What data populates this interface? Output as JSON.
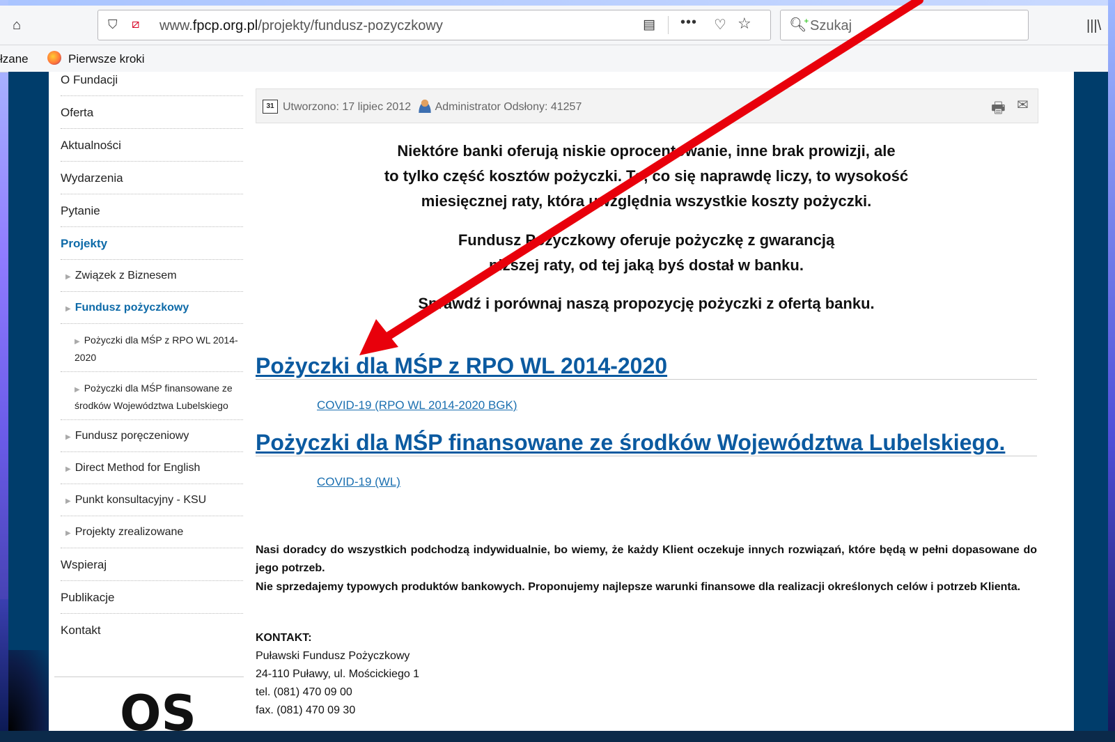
{
  "browser": {
    "url_prefix": "www.",
    "url_host": "fpcp.org.pl",
    "url_path": "/projekty/fundusz-pozyczkowy",
    "search_placeholder": "Szukaj",
    "bookmark_cut": "łzane",
    "bookmark_label": "Pierwsze kroki"
  },
  "sidebar": {
    "items": [
      {
        "label": "O Fundacji"
      },
      {
        "label": "Oferta"
      },
      {
        "label": "Aktualności"
      },
      {
        "label": "Wydarzenia"
      },
      {
        "label": "Pytanie"
      },
      {
        "label": "Projekty"
      }
    ],
    "sub": [
      {
        "label": "Związek z Biznesem"
      },
      {
        "label": "Fundusz pożyczkowy"
      }
    ],
    "subsub": [
      {
        "label": "Pożyczki dla MŚP z RPO WL 2014-2020"
      },
      {
        "label": "Pożyczki dla MŚP finansowane ze środków Województwa Lubelskiego"
      }
    ],
    "sub2": [
      {
        "label": "Fundusz poręczeniowy"
      },
      {
        "label": "Direct Method for English"
      },
      {
        "label": "Punkt konsultacyjny - KSU"
      },
      {
        "label": "Projekty zrealizowane"
      }
    ],
    "items2": [
      {
        "label": "Wspieraj"
      },
      {
        "label": "Publikacje"
      },
      {
        "label": "Kontakt"
      }
    ],
    "logo": "OS"
  },
  "article": {
    "info_created": "Utworzono: 17 lipiec 2012",
    "info_author": "Administrator",
    "info_views": "Odsłony: 41257",
    "intro_lines": [
      "Niektóre banki oferują niskie oprocentowanie, inne brak prowizji, ale",
      "to tylko część kosztów pożyczki. To, co się naprawdę liczy, to wysokość",
      "miesięcznej raty, która uwzględnia wszystkie koszty pożyczki."
    ],
    "intro2_lines": [
      "Fundusz Pożyczkowy oferuje pożyczkę z gwarancją",
      "niższej raty, od tej jaką byś dostał w banku."
    ],
    "intro3": "Sprawdź i porównaj naszą propozycję pożyczki z ofertą banku.",
    "section1_title": "Pożyczki dla MŚP z RPO WL 2014-2020",
    "section1_link": "COVID-19 (RPO WL 2014-2020 BGK)",
    "section2_title": "Pożyczki dla MŚP finansowane ze środków Województwa Lubelskiego.",
    "section2_link": "COVID-19 (WL)",
    "para1": "Nasi doradcy do wszystkich podchodzą indywidualnie, bo wiemy, że każdy Klient oczekuje innych rozwiązań, które będą w pełni dopasowane do jego potrzeb.",
    "para2": "Nie sprzedajemy typowych produktów bankowych. Proponujemy najlepsze warunki finansowe dla realizacji określonych celów i potrzeb Klienta.",
    "contact_head": "KONTAKT:",
    "contact_lines": [
      "Puławski Fundusz Pożyczkowy",
      "24-110 Puławy, ul. Mościckiego 1",
      "tel. (081) 470 09 00",
      "fax. (081) 470 09 30"
    ]
  },
  "annotation": {
    "arrow_color": "#e8000b"
  }
}
